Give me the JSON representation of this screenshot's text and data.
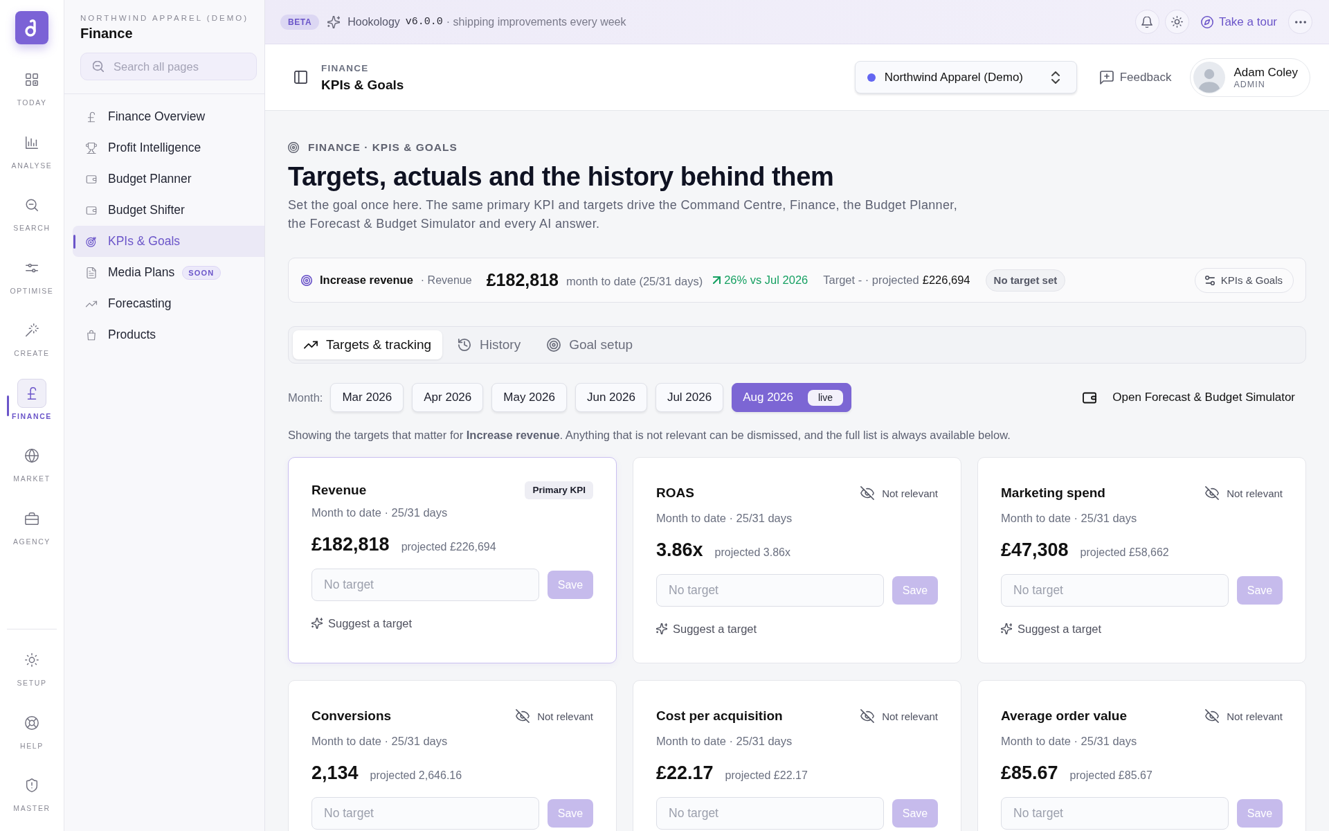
{
  "rail": {
    "items": [
      {
        "label": "TODAY",
        "selected": false
      },
      {
        "label": "ANALYSE",
        "selected": false
      },
      {
        "label": "SEARCH",
        "selected": false
      },
      {
        "label": "OPTIMISE",
        "selected": false
      },
      {
        "label": "CREATE",
        "selected": false
      },
      {
        "label": "FINANCE",
        "selected": true
      },
      {
        "label": "MARKET",
        "selected": false
      },
      {
        "label": "AGENCY",
        "selected": false
      }
    ],
    "bottom_items": [
      {
        "label": "SETUP",
        "selected": false
      },
      {
        "label": "HELP",
        "selected": false
      },
      {
        "label": "MASTER",
        "selected": false
      }
    ]
  },
  "sidebar": {
    "org": "NORTHWIND APPAREL (DEMO)",
    "title": "Finance",
    "search": {
      "placeholder": "Search all pages"
    },
    "items": [
      {
        "label": "Finance Overview",
        "selected": false
      },
      {
        "label": "Profit Intelligence",
        "selected": false
      },
      {
        "label": "Budget Planner",
        "selected": false
      },
      {
        "label": "Budget Shifter",
        "selected": false
      },
      {
        "label": "KPIs & Goals",
        "selected": true
      },
      {
        "label": "Media Plans",
        "selected": false,
        "badge": "SOON"
      },
      {
        "label": "Forecasting",
        "selected": false
      },
      {
        "label": "Products",
        "selected": false
      }
    ]
  },
  "banner": {
    "badge": "BETA",
    "product": "Hookology",
    "version": "v6.0.0",
    "tagline": "· shipping improvements every week",
    "tour": "Take a tour"
  },
  "header": {
    "eyebrow": "FINANCE",
    "title": "KPIs & Goals",
    "org_select": {
      "value": "Northwind Apparel (Demo)"
    },
    "feedback": "Feedback",
    "user": {
      "name": "Adam Coley",
      "role": "ADMIN"
    }
  },
  "page": {
    "breadcrumb": "FINANCE · KPIS & GOALS",
    "title": "Targets, actuals and the history behind them",
    "description": "Set the goal once here. The same primary KPI and targets drive the Command Centre, Finance, the Budget Planner, the Forecast & Budget Simulator and every AI answer."
  },
  "summary": {
    "goal": "Increase revenue",
    "metric": "· Revenue",
    "value": "£182,818",
    "period": "month to date (25/31 days)",
    "change": "26% vs Jul 2026",
    "target": "Target - · projected",
    "projected": "£226,694",
    "status": "No target set",
    "button": "KPIs & Goals"
  },
  "tabs": [
    {
      "label": "Targets & tracking",
      "selected": true
    },
    {
      "label": "History",
      "selected": false
    },
    {
      "label": "Goal setup",
      "selected": false
    }
  ],
  "months": {
    "label": "Month:",
    "items": [
      {
        "label": "Mar 2026",
        "selected": false
      },
      {
        "label": "Apr 2026",
        "selected": false
      },
      {
        "label": "May 2026",
        "selected": false
      },
      {
        "label": "Jun 2026",
        "selected": false
      },
      {
        "label": "Jul 2026",
        "selected": false
      },
      {
        "label": "Aug 2026",
        "selected": true,
        "badge": "live"
      }
    ],
    "action": "Open Forecast & Budget Simulator"
  },
  "note": "Showing the targets that matter for **Increase revenue**. Anything that is not relevant can be dismissed, and the full list is always available below.",
  "cards": [
    {
      "title": "Revenue",
      "primary": true,
      "badge": "Primary KPI",
      "subtitle": "Month to date · 25/31 days",
      "value": "£182,818",
      "projected": "projected £226,694",
      "input": {
        "placeholder": "No target"
      },
      "save": {
        "label": "Save",
        "disabled": true
      },
      "suggest": "Suggest a target"
    },
    {
      "title": "ROAS",
      "primary": false,
      "dismiss": "Not relevant",
      "subtitle": "Month to date · 25/31 days",
      "value": "3.86x",
      "projected": "projected 3.86x",
      "input": {
        "placeholder": "No target"
      },
      "save": {
        "label": "Save",
        "disabled": true
      },
      "suggest": "Suggest a target"
    },
    {
      "title": "Marketing spend",
      "primary": false,
      "dismiss": "Not relevant",
      "subtitle": "Month to date · 25/31 days",
      "value": "£47,308",
      "projected": "projected £58,662",
      "input": {
        "placeholder": "No target"
      },
      "save": {
        "label": "Save",
        "disabled": true
      },
      "suggest": "Suggest a target"
    },
    {
      "title": "Conversions",
      "primary": false,
      "dismiss": "Not relevant",
      "subtitle": "Month to date · 25/31 days",
      "value": "2,134",
      "projected": "projected 2,646.16",
      "input": {
        "placeholder": "No target"
      },
      "save": {
        "label": "Save",
        "disabled": true
      }
    },
    {
      "title": "Cost per acquisition",
      "primary": false,
      "dismiss": "Not relevant",
      "subtitle": "Month to date · 25/31 days",
      "value": "£22.17",
      "projected": "projected £22.17",
      "input": {
        "placeholder": "No target"
      },
      "save": {
        "label": "Save",
        "disabled": true
      }
    },
    {
      "title": "Average order value",
      "primary": false,
      "dismiss": "Not relevant",
      "subtitle": "Month to date · 25/31 days",
      "value": "£85.67",
      "projected": "projected £85.67",
      "input": {
        "placeholder": "No target"
      },
      "save": {
        "label": "Save",
        "disabled": true
      }
    }
  ]
}
